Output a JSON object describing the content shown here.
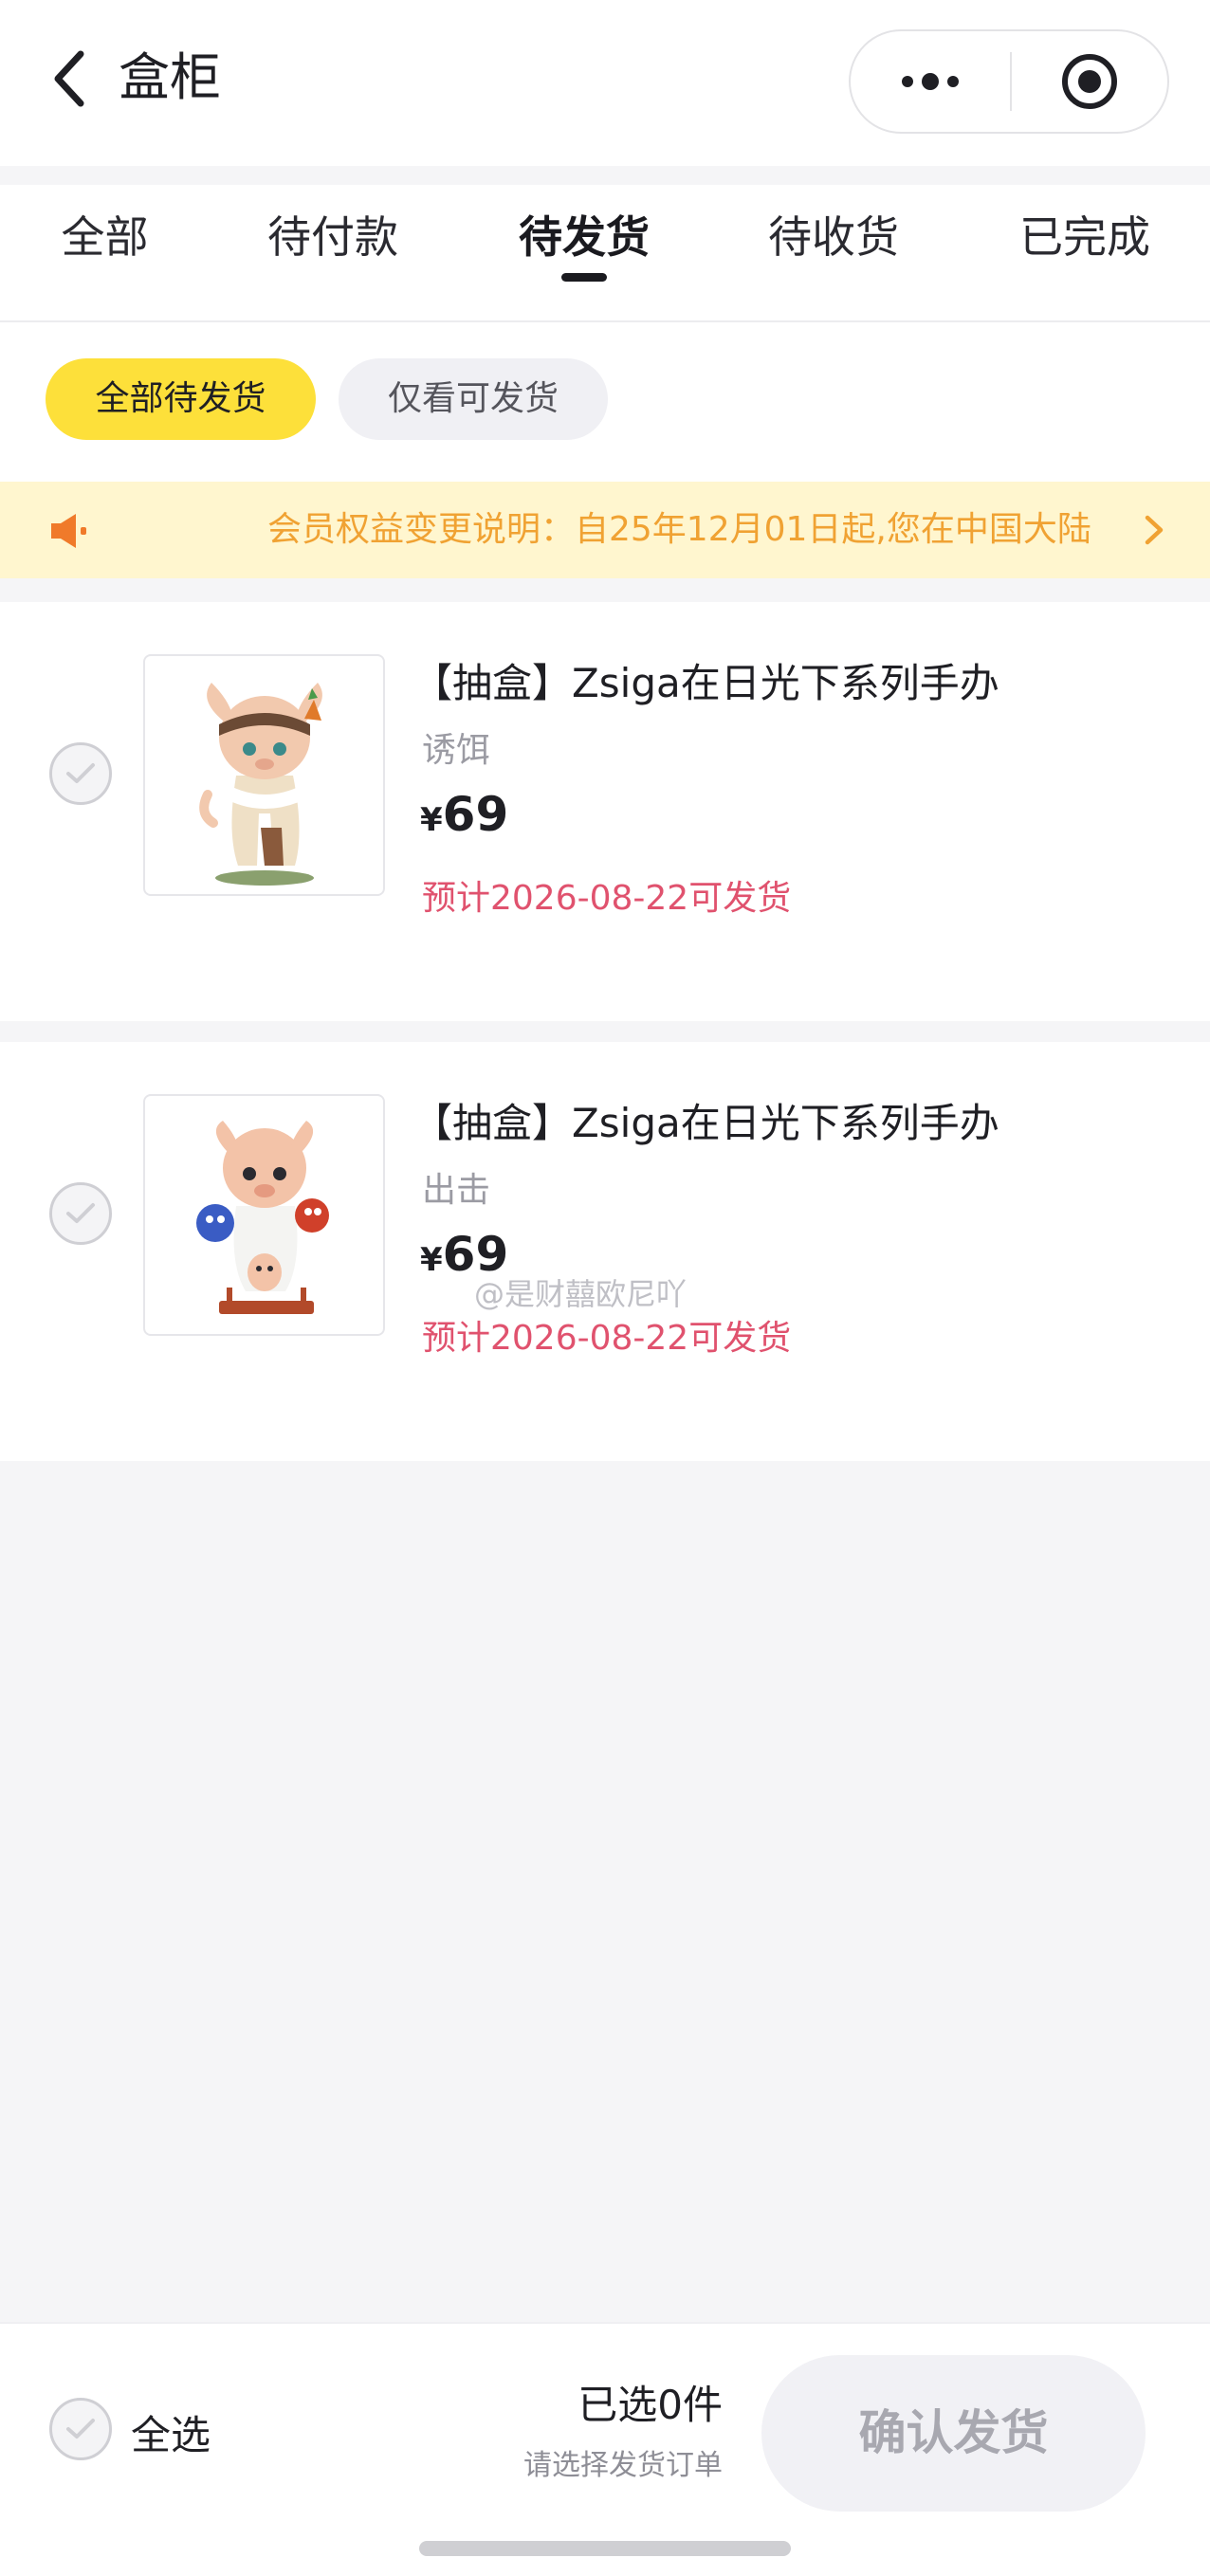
{
  "header": {
    "title": "盒柜",
    "back_icon": "chevron-left-icon",
    "more_icon": "more-dots-icon",
    "close_icon": "target-close-icon"
  },
  "tabs": [
    {
      "label": "全部",
      "active": false
    },
    {
      "label": "待付款",
      "active": false
    },
    {
      "label": "待发货",
      "active": true
    },
    {
      "label": "待收货",
      "active": false
    },
    {
      "label": "已完成",
      "active": false
    }
  ],
  "filters": {
    "all_label": "全部待发货",
    "ready_label": "仅看可发货",
    "active_color": "#fde03a"
  },
  "notice": {
    "text": "会员权益变更说明：自25年12月01日起,您在中国大陆",
    "icon": "speaker-icon",
    "color": "#f0a233"
  },
  "items": [
    {
      "name": "【抽盒】Zsiga在日光下系列手办",
      "variant": "诱饵",
      "currency": "¥",
      "price": "69",
      "eta": "预计2026-08-22可发货"
    },
    {
      "name": "【抽盒】Zsiga在日光下系列手办",
      "variant": "出击",
      "currency": "¥",
      "price": "69",
      "eta": "预计2026-08-22可发货"
    }
  ],
  "watermark": "@是财囍欧尼吖",
  "bottom_bar": {
    "select_all_label": "全选",
    "selected_count": "已选0件",
    "hint": "请选择发货订单",
    "confirm_label": "确认发货"
  }
}
